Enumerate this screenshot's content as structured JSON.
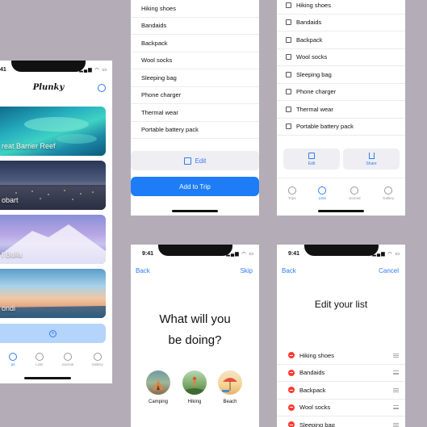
{
  "time": "9:41",
  "time_clipped": "41",
  "status_icons": "▂▄▆ ◠ ▭",
  "colors": {
    "accent": "#2f7cf6",
    "primary_button": "#1e7cf7",
    "delete": "#ff3b30",
    "background": "#b4adb8"
  },
  "home_screen": {
    "app_title": "Plunky",
    "destinations": [
      {
        "label": "reat Barrier Reef"
      },
      {
        "label": "obart"
      },
      {
        "label": "t Bulla"
      },
      {
        "label": "ondi"
      }
    ],
    "add_icon": "plus-circle-icon",
    "tabs": [
      "ps",
      "Lists",
      "Journal",
      "Gallery"
    ]
  },
  "packing_list_top": {
    "items": [
      "Hiking shoes",
      "Bandaids",
      "Backpack",
      "Wool socks",
      "Sleeping bag",
      "Phone charger",
      "Thermal wear",
      "Portable battery pack"
    ],
    "edit_label": "Edit",
    "add_label": "Add to Trip"
  },
  "checklist": {
    "items": [
      "Hiking shoes",
      "Bandaids",
      "Backpack",
      "Wool socks",
      "Sleeping bag",
      "Phone charger",
      "Thermal wear",
      "Portable battery pack"
    ],
    "edit_label": "Edit",
    "share_label": "Share",
    "tabs": [
      "Trips",
      "Lists",
      "Journal",
      "Gallery"
    ]
  },
  "activities_screen": {
    "back": "Back",
    "skip": "Skip",
    "question_line1": "What will you",
    "question_line2": "be doing?",
    "activities": [
      "Camping",
      "Hiking",
      "Beach"
    ]
  },
  "edit_list_screen": {
    "back": "Back",
    "cancel": "Cancel",
    "title": "Edit your list",
    "items": [
      "Hiking shoes",
      "Bandaids",
      "Backpack",
      "Wool socks",
      "Sleeping bag"
    ]
  }
}
